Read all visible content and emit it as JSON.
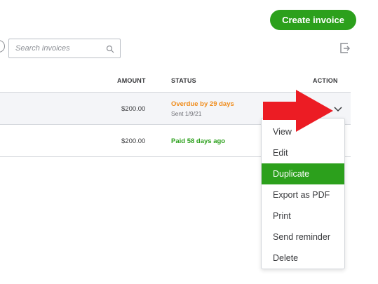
{
  "header": {
    "create_invoice_label": "Create invoice"
  },
  "search": {
    "placeholder": "Search invoices"
  },
  "table": {
    "columns": [
      "AMOUNT",
      "STATUS",
      "ACTION"
    ],
    "rows": [
      {
        "amount": "$200.00",
        "status": "Overdue by 29 days",
        "status_detail": "Sent 1/9/21"
      },
      {
        "amount": "$200.00",
        "status": "Paid 58 days ago"
      }
    ]
  },
  "action_menu": {
    "items": [
      "View",
      "Edit",
      "Duplicate",
      "Export as PDF",
      "Print",
      "Send reminder",
      "Delete"
    ],
    "selected": "Duplicate"
  },
  "colors": {
    "primary_green": "#2ca01c",
    "overdue_orange": "#f08c1b",
    "annotation_red": "#ec1c24"
  },
  "icons": {
    "search": "search-icon",
    "export": "export-icon",
    "menu_toggle": "chevron-down-icon",
    "annotation": "red-arrow-annotation"
  }
}
